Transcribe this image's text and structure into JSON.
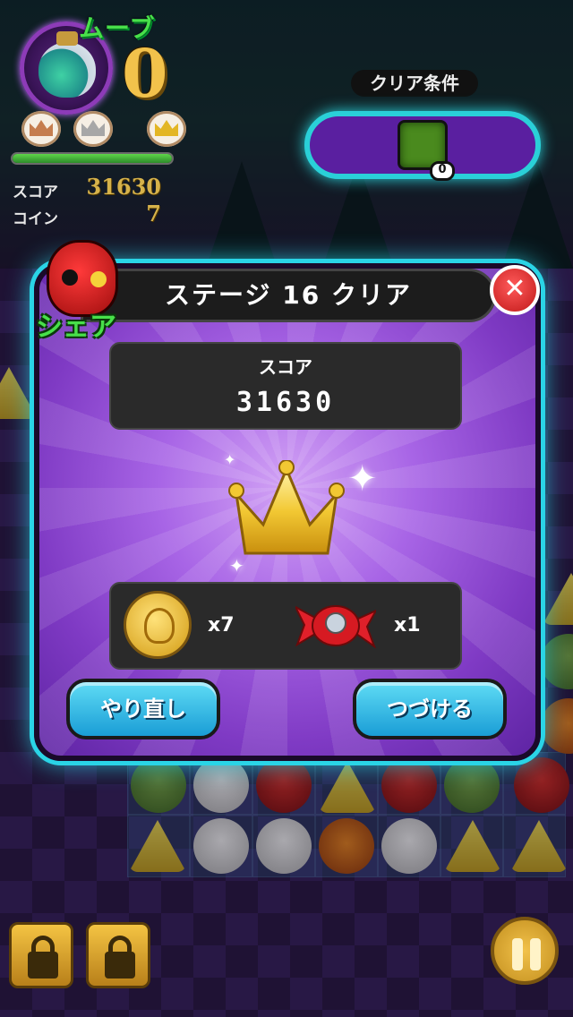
{
  "hud": {
    "moves_label": "ムーブ",
    "moves_value": "0",
    "score_label": "スコア",
    "score_value": "31630",
    "coin_label": "コイン",
    "coin_value": "7",
    "crowns": [
      "bronze",
      "silver",
      "gold"
    ],
    "progress": 1.0
  },
  "goal": {
    "title": "クリア条件",
    "tile_icon": "green-tile-icon",
    "count": "0"
  },
  "modal": {
    "title": "ステージ 16 クリア",
    "share_label": "シェア",
    "close_icon": "close-icon",
    "score_label": "スコア",
    "score_value": "31630",
    "rewards": [
      {
        "icon": "skull-coin-icon",
        "count": "x7"
      },
      {
        "icon": "candy-icon",
        "count": "x1"
      }
    ],
    "retry_button": "やり直し",
    "continue_button": "つづける"
  },
  "colors": {
    "accent_cyan": "#2ad4e6",
    "modal_purple": "#a865e6",
    "moves_green": "#48e04a",
    "gold": "#f2c24b"
  }
}
